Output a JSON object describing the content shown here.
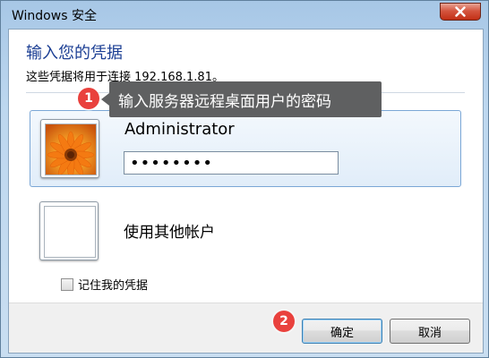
{
  "window": {
    "title": "Windows 安全",
    "close_label": "✕"
  },
  "dialog": {
    "heading": "输入您的凭据",
    "subtitle": "这些凭据将用于连接 192.168.1.81。"
  },
  "credentials": {
    "selected_user": "Administrator",
    "password_masked": "••••••••",
    "other_account_label": "使用其他帐户"
  },
  "remember": {
    "label": "记住我的凭据",
    "checked": false
  },
  "buttons": {
    "ok": "确定",
    "cancel": "取消"
  },
  "annotations": {
    "step1": "1",
    "step1_text": "输入服务器远程桌面用户的密码",
    "step2": "2",
    "badge_color": "#e9413d"
  }
}
